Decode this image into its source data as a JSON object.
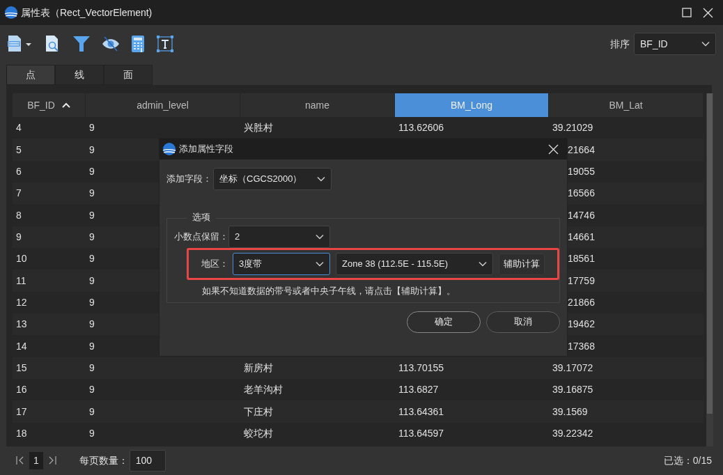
{
  "window": {
    "title": "属性表（Rect_VectorElement)"
  },
  "sort": {
    "label": "排序",
    "value": "BF_ID"
  },
  "tabs": [
    {
      "label": "点",
      "selected": true
    },
    {
      "label": "线",
      "selected": false
    },
    {
      "label": "面",
      "selected": false
    }
  ],
  "table": {
    "columns": [
      {
        "label": "BF_ID",
        "sort_ascending": true,
        "selected": false
      },
      {
        "label": "admin_level",
        "selected": false
      },
      {
        "label": "name",
        "selected": false
      },
      {
        "label": "BM_Long",
        "selected": true
      },
      {
        "label": "BM_Lat",
        "selected": false
      }
    ],
    "rows": [
      {
        "bf_id": "4",
        "admin_level": "9",
        "name": "兴胜村",
        "bm_long": "113.62606",
        "bm_lat": "39.21029"
      },
      {
        "bf_id": "5",
        "admin_level": "9",
        "bm_lat": "21664"
      },
      {
        "bf_id": "6",
        "admin_level": "9",
        "bm_lat": "19055"
      },
      {
        "bf_id": "7",
        "admin_level": "9",
        "bm_lat": "16566"
      },
      {
        "bf_id": "8",
        "admin_level": "9",
        "bm_lat": "14746"
      },
      {
        "bf_id": "9",
        "admin_level": "9",
        "bm_lat": "14661"
      },
      {
        "bf_id": "10",
        "admin_level": "9",
        "bm_lat": "18561"
      },
      {
        "bf_id": "11",
        "admin_level": "9",
        "bm_lat": "17759"
      },
      {
        "bf_id": "12",
        "admin_level": "9",
        "bm_lat": "21866"
      },
      {
        "bf_id": "13",
        "admin_level": "9",
        "bm_lat": "19462"
      },
      {
        "bf_id": "14",
        "admin_level": "9",
        "bm_lat": "17368"
      },
      {
        "bf_id": "15",
        "admin_level": "9",
        "name": "新房村",
        "bm_long": "113.70155",
        "bm_lat": "39.17072"
      },
      {
        "bf_id": "16",
        "admin_level": "9",
        "name": "老羊沟村",
        "bm_long": "113.6827",
        "bm_lat": "39.16875"
      },
      {
        "bf_id": "17",
        "admin_level": "9",
        "name": "下庄村",
        "bm_long": "113.64361",
        "bm_lat": "39.1569"
      },
      {
        "bf_id": "18",
        "admin_level": "9",
        "name": "蛟坨村",
        "bm_long": "113.64597",
        "bm_lat": "39.22342"
      }
    ]
  },
  "footer": {
    "page": "1",
    "page_size_label": "每页数量：",
    "page_size": "100",
    "selected_count": "已选：0/15"
  },
  "dialog": {
    "title": "添加属性字段",
    "field_label": "添加字段：",
    "field_value": "坐标（CGCS2000）",
    "group_title": "选项",
    "decimals_label": "小数点保留：",
    "decimals_value": "2",
    "region_label": "地区：",
    "zone_type": "3度带",
    "zone_type_focused": true,
    "zone": "Zone 38 (112.5E - 115.5E)",
    "helper_button": "辅助计算",
    "hint": "如果不知道数据的带号或者中央子午线，请点击【辅助计算】。",
    "ok": "确定",
    "cancel": "取消"
  }
}
